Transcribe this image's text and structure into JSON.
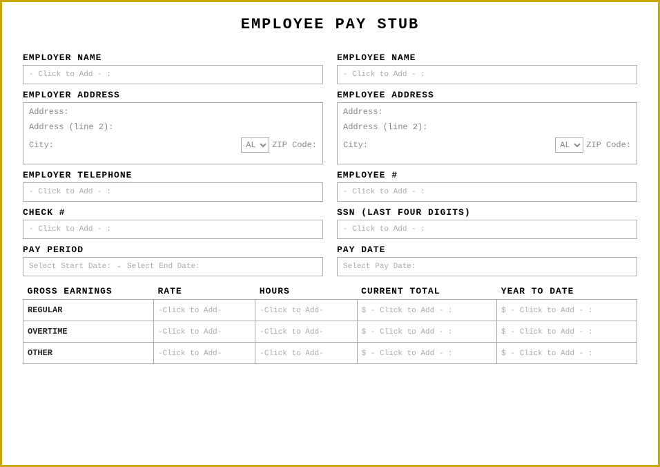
{
  "title": "EMPLOYEE PAY STUB",
  "left": {
    "employer_name_label": "EMPLOYER NAME",
    "employer_name_placeholder": "- Click to Add - :",
    "employer_address_label": "EMPLOYER ADDRESS",
    "address_line1": "Address:",
    "address_line2": "Address (line 2):",
    "city_label": "City:",
    "state_default": "AL",
    "zip_label": "ZIP Code:",
    "employer_tel_label": "EMPLOYER TELEPHONE",
    "employer_tel_placeholder": "- Click to Add - :",
    "check_label": "CHECK #",
    "check_placeholder": "- Click to Add - :",
    "pay_period_label": "PAY PERIOD",
    "pay_period_start": "Select Start Date:",
    "pay_period_dash": "-",
    "pay_period_end": "Select End Date:"
  },
  "right": {
    "employee_name_label": "EMPLOYEE NAME",
    "employee_name_placeholder": "- Click to Add - :",
    "employee_address_label": "EMPLOYEE ADDRESS",
    "address_line1": "Address:",
    "address_line2": "Address (line 2):",
    "city_label": "City:",
    "state_default": "AL",
    "zip_label": "ZIP Code:",
    "employee_num_label": "EMPLOYEE #",
    "employee_num_placeholder": "- Click to Add - :",
    "ssn_label": "SSN (LAST FOUR DIGITS)",
    "ssn_placeholder": "- Click to Add - :",
    "pay_date_label": "PAY DATE",
    "pay_date_placeholder": "Select Pay Date:"
  },
  "earnings": {
    "col_headers": [
      "GROSS EARNINGS",
      "RATE",
      "HOURS",
      "CURRENT TOTAL",
      "YEAR TO DATE"
    ],
    "rows": [
      {
        "label": "REGULAR",
        "rate": "-Click to Add-",
        "hours": "-Click to Add-",
        "current": "$ - Click to Add - :",
        "ytd": "$ - Click to Add - :"
      },
      {
        "label": "OVERTIME",
        "rate": "-Click to Add-",
        "hours": "-Click to Add-",
        "current": "$ - Click to Add - :",
        "ytd": "$ - Click to Add - :"
      },
      {
        "label": "OTHER",
        "rate": "-Click to Add-",
        "hours": "-Click to Add-",
        "current": "$ - Click to Add - :",
        "ytd": "$ - Click to Add - :"
      }
    ]
  }
}
